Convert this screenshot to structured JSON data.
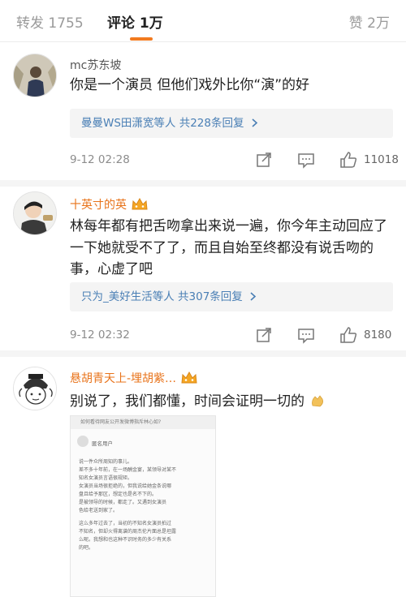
{
  "tabs": {
    "repost": "转发 1755",
    "comments": "评论 1万",
    "likes": "赞 2万"
  },
  "comments": [
    {
      "username": "mc苏东坡",
      "text": "你是一个演员 但他们戏外比你“演”的好",
      "reply_summary": "曼曼WS田潇宽等人 共228条回复",
      "time": "9-12 02:28",
      "likes": "11018"
    },
    {
      "username": "十英寸的英",
      "text": "林每年都有把舌吻拿出来说一遍，你今年主动回应了一下她就受不了了，而且自始至终都没有说舌吻的事，心虚了吧",
      "reply_summary": "只为_美好生活等人 共307条回复",
      "time": "9-12 02:32",
      "likes": "8180"
    },
    {
      "username": "悬胡青天上-埋胡紫…",
      "text": "别说了，我们都懂，时间会证明一切的"
    }
  ],
  "embedded_screenshot": {
    "title": "如何看待网友公开发微博指斥林心如?",
    "user": "匿名用户",
    "lines": [
      "说一件众所周知的事儿。",
      "差不多十年前，在一场酬金宴，某领导对某不",
      "知名女演员言语很规矩。",
      "女演员当场很拒绝的，但我说给她金条说哪",
      "盘且给予那区，想定也是名不下的。",
      "是被领导的时候，都走了。又遇到女演员",
      "色给老送到家了。",
      "这么多年过去了，当初的不知名女演员拍过",
      "不知名，但却火得离谱的周杰伦片面总是坦露",
      "么呢。我想和也这种不识时务的多少有关系",
      "的吧。"
    ]
  },
  "icons": {
    "share": "share-icon",
    "comment": "comment-icon",
    "like": "thumbs-up-icon",
    "crown": "crown-badge-icon",
    "emoji": "clap-emoji-icon"
  },
  "colors": {
    "accent": "#f27a1f",
    "link": "#4a7fb5",
    "vip_name": "#e8731a"
  }
}
